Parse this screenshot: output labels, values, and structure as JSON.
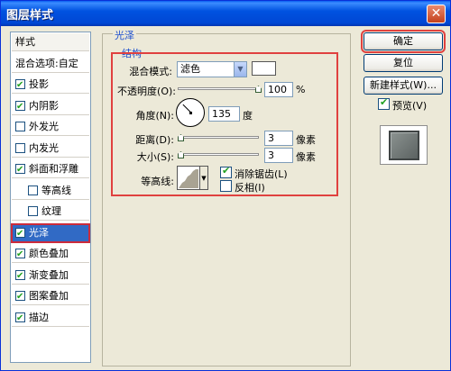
{
  "window": {
    "title": "图层样式"
  },
  "styles_list": {
    "items": [
      {
        "label": "样式",
        "checkbox": false,
        "checked": false,
        "indent": 0
      },
      {
        "label": "混合选项:自定",
        "checkbox": false,
        "checked": false,
        "indent": 0
      },
      {
        "label": "投影",
        "checkbox": true,
        "checked": true,
        "indent": 0
      },
      {
        "label": "内阴影",
        "checkbox": true,
        "checked": true,
        "indent": 0
      },
      {
        "label": "外发光",
        "checkbox": true,
        "checked": false,
        "indent": 0
      },
      {
        "label": "内发光",
        "checkbox": true,
        "checked": false,
        "indent": 0
      },
      {
        "label": "斜面和浮雕",
        "checkbox": true,
        "checked": true,
        "indent": 0
      },
      {
        "label": "等高线",
        "checkbox": true,
        "checked": false,
        "indent": 1
      },
      {
        "label": "纹理",
        "checkbox": true,
        "checked": false,
        "indent": 1
      },
      {
        "label": "光泽",
        "checkbox": true,
        "checked": true,
        "indent": 0,
        "selected": true
      },
      {
        "label": "颜色叠加",
        "checkbox": true,
        "checked": true,
        "indent": 0
      },
      {
        "label": "渐变叠加",
        "checkbox": true,
        "checked": true,
        "indent": 0
      },
      {
        "label": "图案叠加",
        "checkbox": true,
        "checked": true,
        "indent": 0
      },
      {
        "label": "描边",
        "checkbox": true,
        "checked": true,
        "indent": 0
      }
    ]
  },
  "panel": {
    "section_title": "光泽",
    "group_title": "结构",
    "blend_mode": {
      "label": "混合模式:",
      "value": "滤色"
    },
    "opacity": {
      "label": "不透明度(O):",
      "value": "100",
      "unit": "%",
      "level": 1.0
    },
    "angle": {
      "label": "角度(N):",
      "value": "135",
      "unit": "度"
    },
    "distance": {
      "label": "距离(D):",
      "value": "3",
      "unit": "像素"
    },
    "size": {
      "label": "大小(S):",
      "value": "3",
      "unit": "像素"
    },
    "contour": {
      "label": "等高线:",
      "antialias_label": "消除锯齿(L)",
      "antialias_checked": true,
      "invert_label": "反相(I)",
      "invert_checked": false
    }
  },
  "buttons": {
    "ok": "确定",
    "reset": "复位",
    "new_style": "新建样式(W)...",
    "preview_label": "预览(V)",
    "preview_checked": true
  },
  "colors": {
    "title_bar": "#0054e3",
    "accent_red": "#e0413f",
    "selection": "#316ac5",
    "section_blue": "#1d4fcf"
  }
}
